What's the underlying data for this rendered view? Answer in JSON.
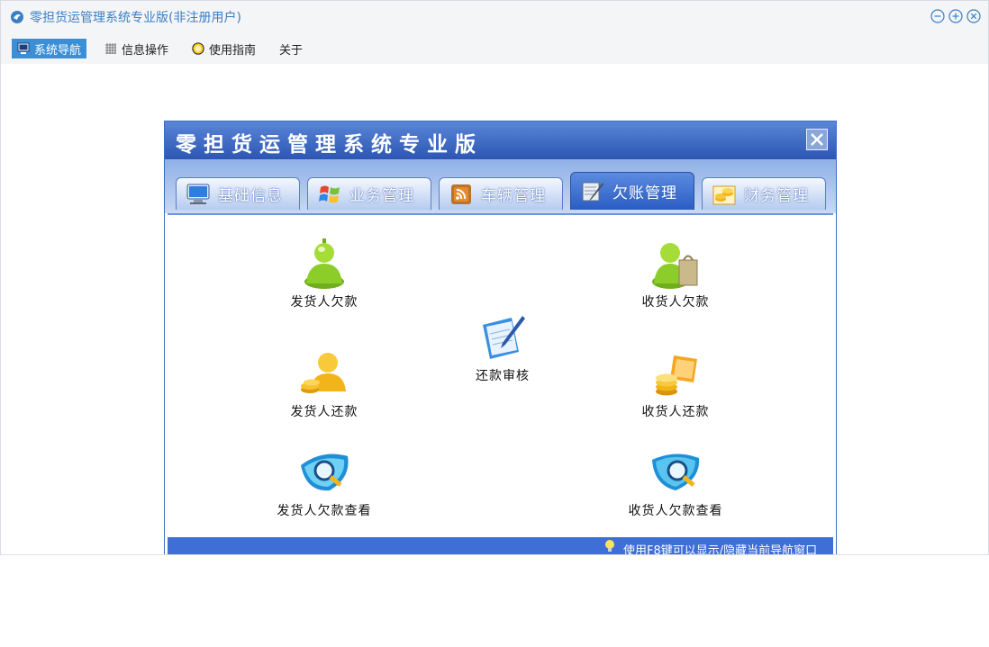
{
  "window": {
    "title": "零担货运管理系统专业版(非注册用户)",
    "accent": "#3b8fd6"
  },
  "menubar": {
    "items": [
      {
        "label": "系统导航",
        "icon": "monitor-icon",
        "active": true
      },
      {
        "label": "信息操作",
        "icon": "grid-icon",
        "active": false
      },
      {
        "label": "使用指南",
        "icon": "help-icon",
        "active": false
      },
      {
        "label": "关于",
        "icon": "",
        "active": false
      }
    ]
  },
  "navigator": {
    "title": "零担货运管理系统专业版",
    "tabs": [
      {
        "label": "基础信息",
        "icon": "computer-icon"
      },
      {
        "label": "业务管理",
        "icon": "windows-flag-icon"
      },
      {
        "label": "车辆管理",
        "icon": "rss-feed-icon"
      },
      {
        "label": "欠账管理",
        "icon": "notebook-pen-icon",
        "active": true
      },
      {
        "label": "财务管理",
        "icon": "coins-icon"
      }
    ],
    "items": {
      "shipper_debt": "发货人欠款",
      "consignee_debt": "收货人欠款",
      "repay_audit": "还款审核",
      "shipper_repay": "发货人还款",
      "consignee_repay": "收货人还款",
      "shipper_debt_view": "发货人欠款查看",
      "consignee_debt_view": "收货人欠款查看"
    },
    "footer_hint": "使用F8键可以显示/隐藏当前导航窗口"
  }
}
